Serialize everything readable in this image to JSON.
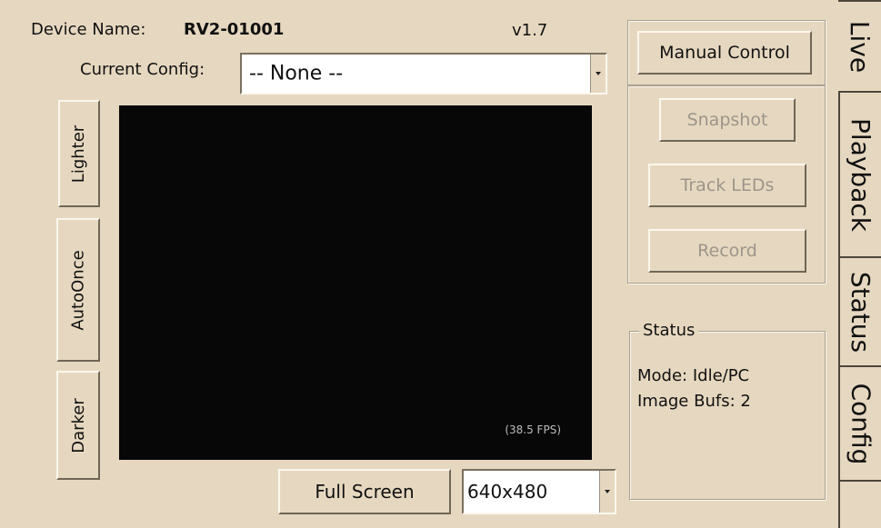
{
  "header": {
    "device_name_label": "Device Name:",
    "device_name_value": "RV2-01001",
    "version": "v1.7",
    "current_config_label": "Current Config:"
  },
  "config_select": {
    "value": "-- None --"
  },
  "brightness": {
    "lighter_label": "Lighter",
    "autoonce_label": "AutoOnce",
    "darker_label": "Darker"
  },
  "video": {
    "fps": "(38.5 FPS)"
  },
  "bottom": {
    "fullscreen_label": "Full Screen",
    "resolution_value": "640x480"
  },
  "controls": {
    "manual_control_label": "Manual Control",
    "snapshot_label": "Snapshot",
    "track_leds_label": "Track LEDs",
    "record_label": "Record"
  },
  "status": {
    "title": "Status",
    "mode": "Mode: Idle/PC",
    "image_bufs": "Image Bufs: 2"
  },
  "tabs": [
    {
      "label": "Live",
      "active": true
    },
    {
      "label": "Playback",
      "active": false
    },
    {
      "label": "Status",
      "active": false
    },
    {
      "label": "Config",
      "active": false
    }
  ]
}
